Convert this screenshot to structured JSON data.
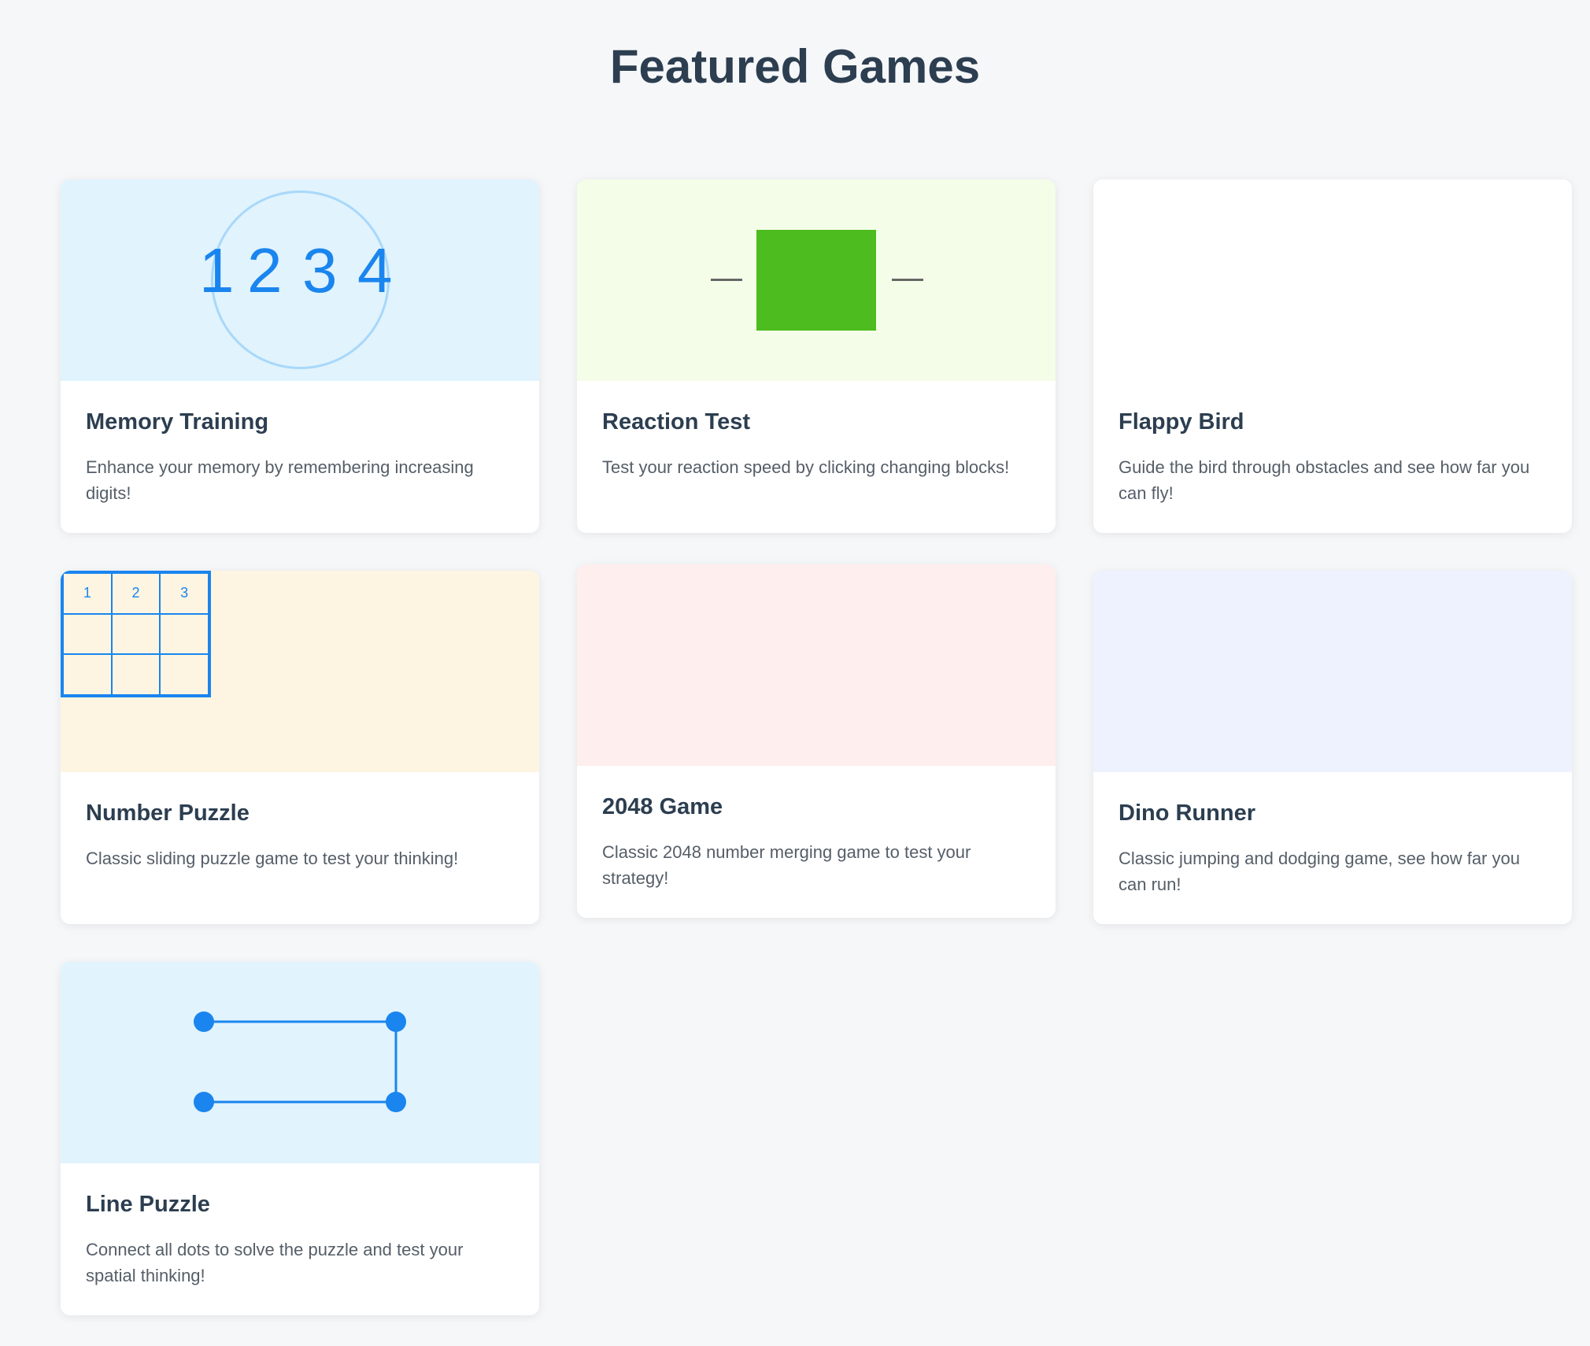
{
  "page": {
    "title": "Featured Games"
  },
  "colors": {
    "accent": "#1a85ef",
    "title": "#2c3e50",
    "text": "#555e68",
    "reaction_block": "#4cbc1e"
  },
  "games": [
    {
      "title": "Memory Training",
      "description": "Enhance your memory by remembering increasing digits!",
      "preview_bg": "#e1f3fd",
      "preview_digits": [
        "1",
        "2",
        "3",
        "4"
      ]
    },
    {
      "title": "Reaction Test",
      "description": "Test your reaction speed by clicking changing blocks!",
      "preview_bg": "#f4fde8"
    },
    {
      "title": "Flappy Bird",
      "description": "Guide the bird through obstacles and see how far you can fly!",
      "preview_bg": "#ffffff"
    },
    {
      "title": "Number Puzzle",
      "description": "Classic sliding puzzle game to test your thinking!",
      "preview_bg": "#fdf5e2",
      "preview_cells": [
        "1",
        "2",
        "3",
        "",
        "",
        "",
        "",
        "",
        ""
      ]
    },
    {
      "title": "2048 Game",
      "description": "Classic 2048 number merging game to test your strategy!",
      "preview_bg": "#ffeeee"
    },
    {
      "title": "Dino Runner",
      "description": "Classic jumping and dodging game, see how far you can run!",
      "preview_bg": "#edf2fe"
    },
    {
      "title": "Line Puzzle",
      "description": "Connect all dots to solve the puzzle and test your spatial thinking!",
      "preview_bg": "#e1f3fd"
    }
  ]
}
